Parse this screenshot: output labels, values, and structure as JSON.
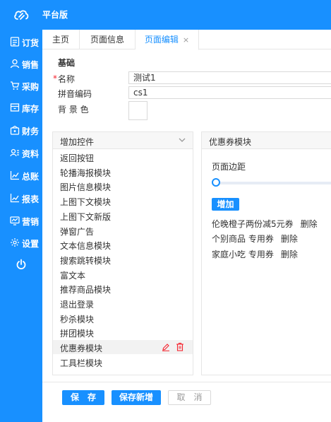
{
  "app": {
    "title": "平台版",
    "logo_icon": "cloud-logo-icon"
  },
  "sidebar": {
    "items": [
      {
        "label": "订货",
        "icon": "order-icon"
      },
      {
        "label": "销售",
        "icon": "user-icon"
      },
      {
        "label": "采购",
        "icon": "cart-icon"
      },
      {
        "label": "库存",
        "icon": "warehouse-icon"
      },
      {
        "label": "财务",
        "icon": "wallet-icon"
      },
      {
        "label": "资料",
        "icon": "profile-icon"
      },
      {
        "label": "总账",
        "icon": "ledger-chart-icon"
      },
      {
        "label": "报表",
        "icon": "report-chart-icon"
      },
      {
        "label": "营销",
        "icon": "marketing-icon"
      },
      {
        "label": "设置",
        "icon": "gear-icon"
      }
    ],
    "power_icon": "power-icon"
  },
  "tabs": [
    {
      "label": "主页"
    },
    {
      "label": "页面信息"
    },
    {
      "label": "页面编辑",
      "closable": true,
      "close_glyph": "×"
    }
  ],
  "form": {
    "section_title": "基础",
    "required_mark": "*",
    "name_label": "名称",
    "name_value": "测试1",
    "code_label": "拼音编码",
    "code_value": "cs1",
    "bg_label": "背 景 色",
    "bg_color": "#ffffff"
  },
  "modules_panel": {
    "title": "增加控件",
    "items": [
      "返回按钮",
      "轮播海报模块",
      "图片信息模块",
      "上图下文模块",
      "上图下文新版",
      "弹窗广告",
      "文本信息模块",
      "搜索跳转模块",
      "富文本",
      "推荐商品模块",
      "退出登录",
      "秒杀模块",
      "拼团模块",
      "优惠券模块",
      "工具栏模块"
    ],
    "selected_index": 13
  },
  "coupon_panel": {
    "title": "优惠券模块",
    "margin_label": "页面边距",
    "margin_value": 0,
    "add_label": "增加",
    "coupons": [
      {
        "name": "伦晚橙子两份减5元券",
        "delete": "删除"
      },
      {
        "name": "个别商品 专用券",
        "delete": "删除"
      },
      {
        "name": "家庭小吃 专用券",
        "delete": "删除"
      }
    ]
  },
  "buttons": {
    "save": "保　存",
    "save_new": "保存新增",
    "cancel": "取　消"
  },
  "colors": {
    "accent": "#1890ff",
    "danger": "#f5222d"
  }
}
